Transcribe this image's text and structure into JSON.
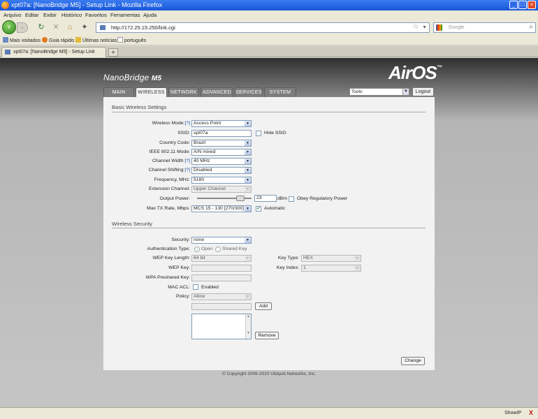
{
  "window": {
    "title": "xpt07a: [NanoBridge M5] - Setup Link - Mozilla Firefox",
    "buttons": {
      "minimize": "_",
      "maximize": "□",
      "close": "×"
    }
  },
  "menu": {
    "items": [
      "Arquivo",
      "Editar",
      "Exibir",
      "Histórico",
      "Favoritos",
      "Ferramentas",
      "Ajuda"
    ]
  },
  "nav": {
    "url": "http://172.25.15.250/link.cgi",
    "search_placeholder": "Google"
  },
  "bookmarks": [
    "Mais visitados",
    "Guia rápido",
    "Últimas notícias",
    "português"
  ],
  "tabs": [
    {
      "label": "xpt07a: [NanoBridge M5] - Setup Link",
      "active": true
    }
  ],
  "brand": {
    "product": "NanoBridge",
    "model": "M5",
    "logo": "AirOS",
    "logo_tm": "™"
  },
  "main_tabs": [
    "MAIN",
    "WIRELESS",
    "NETWORK",
    "ADVANCED",
    "SERVICES",
    "SYSTEM"
  ],
  "active_tab": "WIRELESS",
  "toolbar": {
    "tools": "Tools:",
    "logout": "Logout"
  },
  "wireless": {
    "section_title": "Basic Wireless Settings",
    "help": "[?]",
    "wireless_mode": {
      "label": "Wireless Mode:",
      "value": "Access Point"
    },
    "ssid": {
      "label": "SSID:",
      "value": "xpt07a",
      "hide_label": "Hide SSID",
      "hide_checked": false
    },
    "country_code": {
      "label": "Country Code:",
      "value": "Brazil"
    },
    "ieee_mode": {
      "label": "IEEE 802.11 Mode:",
      "value": "A/N mixed"
    },
    "channel_width": {
      "label": "Channel Width:",
      "value": "40 MHz"
    },
    "channel_shifting": {
      "label": "Channel Shifting:",
      "value": "Disabled"
    },
    "frequency": {
      "label": "Frequency, MHz:",
      "value": "5180"
    },
    "extension_channel": {
      "label": "Extension Channel:",
      "value": "Upper Channel"
    },
    "output_power": {
      "label": "Output Power:",
      "value": "23",
      "unit": "dBm",
      "obey_label": "Obey Regulatory Power",
      "obey_checked": false,
      "level": 0.85
    },
    "max_tx_rate": {
      "label": "Max TX Rate, Mbps:",
      "value": "MCS 15 - 130 [270/300]",
      "auto_label": "Automatic",
      "auto_checked": true
    }
  },
  "security": {
    "section_title": "Wireless Security",
    "security": {
      "label": "Security:",
      "value": "none"
    },
    "auth_type": {
      "label": "Authentication Type:",
      "options": [
        "Open",
        "Shared Key"
      ],
      "selected": "Open"
    },
    "wep_key_length": {
      "label": "WEP Key Length:",
      "value": "64 bit"
    },
    "key_type": {
      "label": "Key Type:",
      "value": "HEX"
    },
    "wep_key": {
      "label": "WEP Key:",
      "value": ""
    },
    "key_index": {
      "label": "Key Index:",
      "value": "1"
    },
    "wpa_key": {
      "label": "WPA Preshared Key:",
      "value": ""
    },
    "mac_acl": {
      "label": "MAC ACL:",
      "enabled_label": "Enabled",
      "checked": false
    },
    "policy": {
      "label": "Policy:",
      "value": "Allow"
    },
    "add_button": "Add",
    "remove_button": "Remove"
  },
  "change_button": "Change",
  "copyright": "© Copyright 2006-2010 Ubiquiti Networks, Inc.",
  "status": {
    "showip": "ShowIP",
    "icon": "x-icon"
  }
}
